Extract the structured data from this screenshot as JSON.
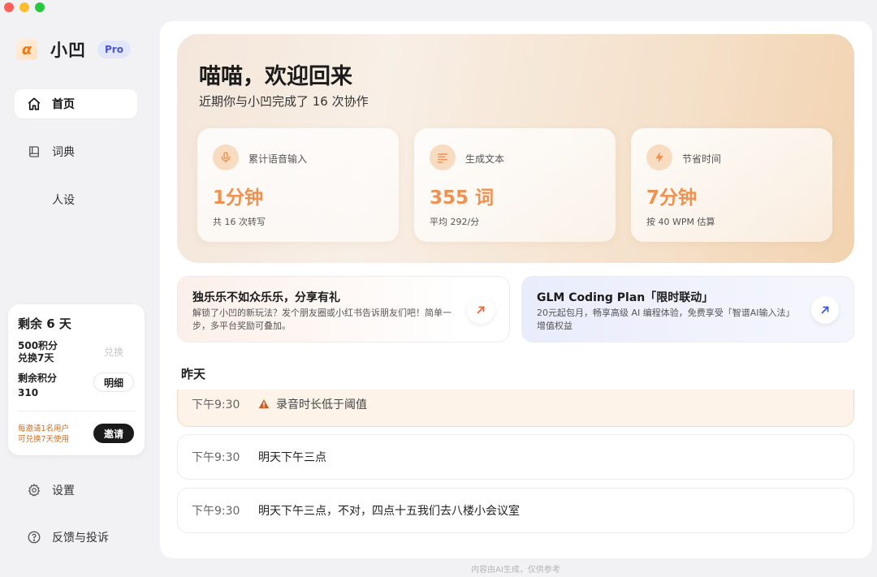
{
  "brand": {
    "name": "小凹",
    "badge": "Pro"
  },
  "nav": {
    "home": "首页",
    "dictionary": "词典",
    "persona": "人设",
    "settings": "设置",
    "feedback": "反馈与投诉"
  },
  "credits": {
    "title": "剩余 6 天",
    "exchange_line1": "500积分",
    "exchange_line2": "兑换7天",
    "exchange_button": "兑换",
    "remaining_label": "剩余积分",
    "remaining_value": "310",
    "detail_button": "明细",
    "invite_note_1": "每邀请1名用户",
    "invite_note_2": "可兑换7天使用",
    "invite_button": "邀请"
  },
  "hero": {
    "title": "喵喵，欢迎回来",
    "subtitle": "近期你与小凹完成了 16 次协作",
    "stats": [
      {
        "icon": "microphone-icon",
        "label": "累计语音输入",
        "value": "1分钟",
        "note": "共 16 次转写"
      },
      {
        "icon": "text-lines-icon",
        "label": "生成文本",
        "value": "355 词",
        "note": "平均 292/分"
      },
      {
        "icon": "lightning-icon",
        "label": "节省时间",
        "value": "7分钟",
        "note": "按 40 WPM 估算"
      }
    ]
  },
  "promos": [
    {
      "title": "独乐乐不如众乐乐，分享有礼",
      "desc": "解锁了小凹的新玩法？发个朋友圈或小红书告诉朋友们吧！简单一步，多平台奖励可叠加。",
      "arrow_color": "#e8643a"
    },
    {
      "title": "GLM Coding Plan「限时联动」",
      "desc": "20元起包月，畅享高级 AI 编程体验，免费享受「智谱AI输入法」增值权益",
      "arrow_color": "#3b55d9"
    }
  ],
  "history": {
    "section": "昨天",
    "rows": [
      {
        "time": "下午9:30",
        "text": "录音时长低于阈值",
        "warning": true
      },
      {
        "time": "下午9:30",
        "text": "明天下午三点",
        "warning": false
      },
      {
        "time": "下午9:30",
        "text": "明天下午三点，不对，四点十五我们去八楼小会议室",
        "warning": false
      }
    ]
  },
  "footer": "内容由AI生成，仅供参考",
  "colors": {
    "accent": "#ef9150",
    "invite_note": "#d46a1b",
    "pro_badge_bg": "#e2e6fb"
  }
}
